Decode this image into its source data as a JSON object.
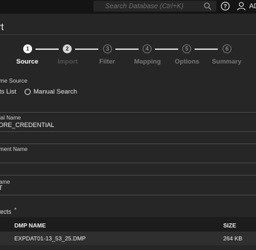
{
  "header": {
    "search_placeholder": "Search Database (Ctrl+K)",
    "help_icon": "help-circle-icon",
    "user_icon": "user-icon",
    "user_label": "AD"
  },
  "page": {
    "title": "rt"
  },
  "wizard": {
    "current_step": 1,
    "steps": [
      {
        "number": "1",
        "label": "Source",
        "state": "current"
      },
      {
        "number": "2",
        "label": "Import",
        "state": "next"
      },
      {
        "number": "3",
        "label": "Filter",
        "state": "todo"
      },
      {
        "number": "4",
        "label": "Mapping",
        "state": "todo"
      },
      {
        "number": "5",
        "label": "Options",
        "state": "todo"
      },
      {
        "number": "6",
        "label": "Summary",
        "state": "todo"
      }
    ]
  },
  "form": {
    "source_label": "me Source",
    "source_options": {
      "list": "ts List",
      "manual": "Manual Search"
    },
    "credential": {
      "label": "ial Name",
      "value": "ORE_CREDENTIAL"
    },
    "bucket": {
      "label": "ment Name",
      "value": ""
    },
    "name": {
      "label": "ame",
      "value": "T"
    },
    "objects_label": "jects",
    "objects_required": "*"
  },
  "table": {
    "columns": [
      "DMP NAME",
      "SIZE"
    ],
    "rows": [
      {
        "name": "EXPDAT01-13_53_25.DMP",
        "size": "264 KB"
      }
    ]
  },
  "colors": {
    "background": "#262626",
    "topbar": "#141414",
    "accent_white": "#ffffff"
  }
}
